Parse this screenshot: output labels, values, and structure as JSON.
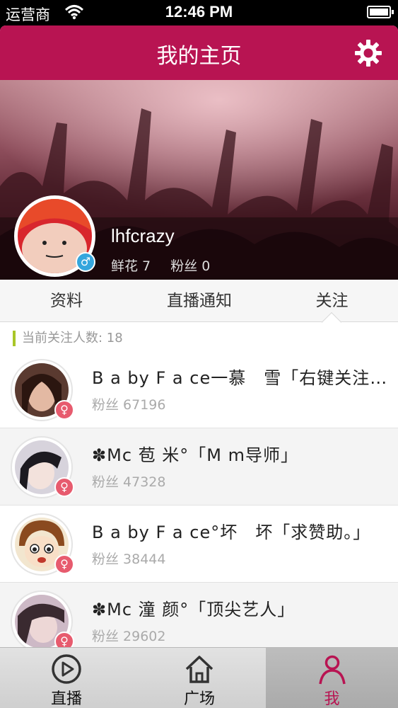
{
  "status_bar": {
    "carrier": "运营商",
    "time": "12:46 PM"
  },
  "navbar": {
    "title": "我的主页",
    "settings_icon": "gear-icon"
  },
  "profile": {
    "username": "lhfcrazy",
    "gender_icon": "male-icon",
    "flowers_label": "鲜花 7",
    "fans_label": "粉丝 0"
  },
  "tabs": [
    {
      "label": "资料"
    },
    {
      "label": "直播通知"
    },
    {
      "label": "关注",
      "selected": true
    }
  ],
  "follow_count": "当前关注人数: 18",
  "following": [
    {
      "name": "B a by F a ce一慕　雪「右键关注加我」",
      "fans": "粉丝 67196",
      "gender_icon": "female-icon"
    },
    {
      "name": "✽Mc 苞  米°「M m导师」",
      "fans": "粉丝 47328",
      "gender_icon": "female-icon"
    },
    {
      "name": "B a by F a ce°坏　坏「求赞助。」",
      "fans": "粉丝 38444",
      "gender_icon": "female-icon"
    },
    {
      "name": "✽Mc 潼  颜°「顶尖艺人」",
      "fans": "粉丝 29602",
      "gender_icon": "female-icon"
    }
  ],
  "tabbar": [
    {
      "label": "直播",
      "icon": "play-circle-icon"
    },
    {
      "label": "广场",
      "icon": "home-icon"
    },
    {
      "label": "我",
      "icon": "person-icon",
      "selected": true
    }
  ],
  "colors": {
    "brand": "#b81452",
    "male": "#35a6dd",
    "female": "#e75b6e",
    "accent_bar": "#a9c628"
  }
}
